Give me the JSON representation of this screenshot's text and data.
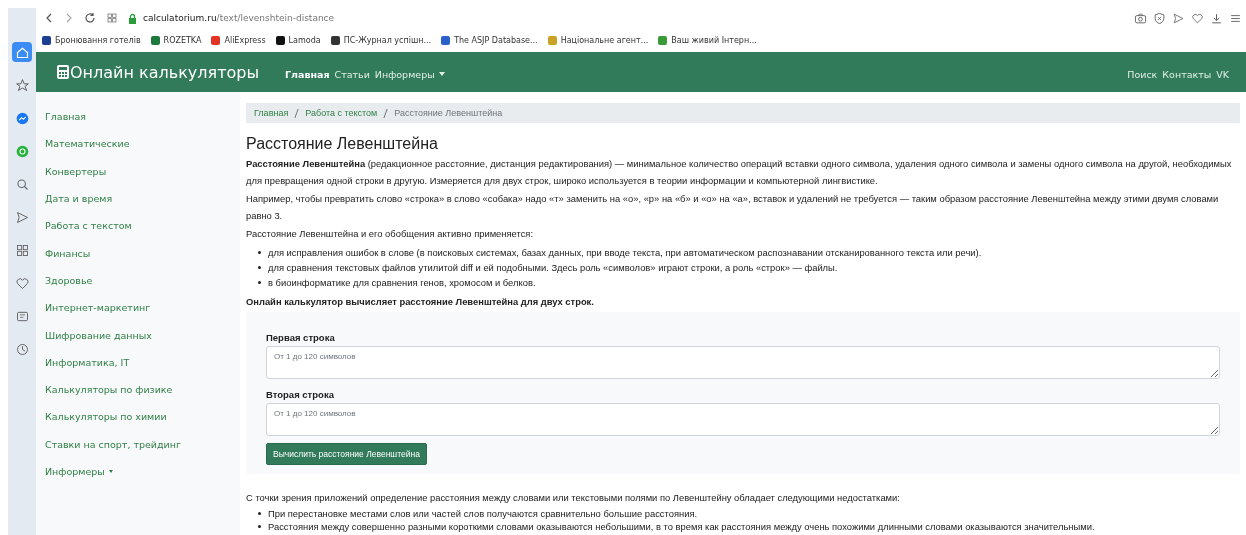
{
  "browser": {
    "url_host": "calculatorium.ru",
    "url_path": "/text/levenshtein-distance",
    "bookmarks": [
      {
        "label": "Бронювання готелів",
        "color": "#1c3f94"
      },
      {
        "label": "ROZETKA",
        "color": "#1d7a3c"
      },
      {
        "label": "AliExpress",
        "color": "#e43225"
      },
      {
        "label": "Lamoda",
        "color": "#111111"
      },
      {
        "label": "ПС-Журнал успішн...",
        "color": "#333333"
      },
      {
        "label": "The ASJP Database...",
        "color": "#2a62c9"
      },
      {
        "label": "Національне агент...",
        "color": "#c9a227"
      },
      {
        "label": "Ваш живий Інтерн...",
        "color": "#3a9a3a"
      }
    ],
    "side_icons": [
      {
        "kind": "home",
        "selected": true
      },
      {
        "kind": "star",
        "selected": false
      },
      {
        "kind": "messenger",
        "selected": false
      },
      {
        "kind": "whatsapp",
        "selected": false
      },
      {
        "kind": "search",
        "selected": false
      },
      {
        "kind": "send",
        "selected": false
      },
      {
        "kind": "grid",
        "selected": false
      },
      {
        "kind": "heart",
        "selected": false
      },
      {
        "kind": "news",
        "selected": false
      },
      {
        "kind": "clock",
        "selected": false
      }
    ]
  },
  "navbar": {
    "brand": "Онлайн калькуляторы",
    "links": [
      {
        "label": "Главная",
        "selected": true,
        "kind": "link"
      },
      {
        "label": "Статьи",
        "selected": false,
        "kind": "link"
      },
      {
        "label": "Информеры",
        "selected": false,
        "kind": "dropdown"
      }
    ],
    "right_links": [
      "Поиск",
      "Контакты",
      "VK"
    ]
  },
  "sidebar": {
    "items": [
      {
        "label": "Главная",
        "kind": "link"
      },
      {
        "label": "Математические",
        "kind": "link"
      },
      {
        "label": "Конвертеры",
        "kind": "link"
      },
      {
        "label": "Дата и время",
        "kind": "link"
      },
      {
        "label": "Работа с текстом",
        "kind": "link"
      },
      {
        "label": "Финансы",
        "kind": "link"
      },
      {
        "label": "Здоровье",
        "kind": "link"
      },
      {
        "label": "Интернет-маркетинг",
        "kind": "link"
      },
      {
        "label": "Шифрование данных",
        "kind": "link"
      },
      {
        "label": "Информатика, IT",
        "kind": "link"
      },
      {
        "label": "Калькуляторы по физике",
        "kind": "link"
      },
      {
        "label": "Калькуляторы по химии",
        "kind": "link"
      },
      {
        "label": "Ставки на спорт, трейдинг",
        "kind": "link"
      },
      {
        "label": "Информеры",
        "kind": "dropdown"
      }
    ]
  },
  "breadcrumb": [
    {
      "label": "Главная",
      "link": true
    },
    {
      "label": "Работа с текстом",
      "link": true
    },
    {
      "label": "Расстояние Левенштейна",
      "link": false
    }
  ],
  "title": "Расстояние Левенштейна",
  "intro": [
    "**Расстояние Левенштейна** (редакционное расстояние, дистанция редактирования) — минимальное количество операций вставки одного символа, удаления одного символа и замены одного символа на другой, необходимых для превращения одной строки в другую. Измеряется для двух строк, широко используется в теории информации и компьютерной лингвистике.",
    "Например, чтобы превратить слово «строка» в слово «собака» надо «т» заменить на «о», «р» на «б» и «о» на «а», вставок и удалений не требуется — таким образом расстояние Левенштейна между этими двумя словами равно 3.",
    "Расстояние Левенштейна и его обобщения активно применяется:"
  ],
  "uses": [
    "для исправления ошибок в слове (в поисковых системах, базах данных, при вводе текста, при автоматическом распознавании отсканированного текста или речи).",
    "для сравнения текстовых файлов утилитой diff и ей подобными. Здесь роль «символов» играют строки, а роль «строк» — файлы.",
    "в биоинформатике для сравнения генов, хромосом и белков."
  ],
  "calc_note": "Онлайн калькулятор вычисляет расстояние Левенштейна для двух строк.",
  "form": {
    "fields": [
      {
        "label": "Первая строка",
        "placeholder": "От 1 до 120 символов"
      },
      {
        "label": "Вторая строка",
        "placeholder": "От 1 до 120 символов"
      }
    ],
    "button": "Вычислить расстояние Левенштейна"
  },
  "drawbacks_intro": "С точки зрения приложений определение расстояния между словами или текстовыми полями по Левенштейну обладает следующими недостатками:",
  "drawbacks": [
    "При перестановке местами слов или частей слов получаются сравнительно большие расстояния.",
    "Расстояния между совершенно разными короткими словами оказываются небольшими, в то время как расстояния между очень похожими длинными словами оказываются значительными."
  ]
}
